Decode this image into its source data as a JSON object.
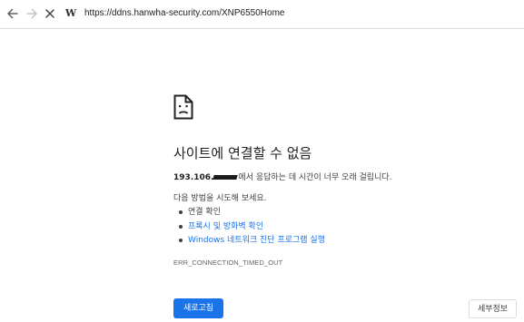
{
  "browser": {
    "address_bar": "https://ddns.hanwha-security.com/XNP6550Home",
    "favicon_glyph": "W",
    "icons": {
      "back": "arrow-left-icon",
      "forward": "arrow-right-icon",
      "stop": "close-icon"
    }
  },
  "error_page": {
    "icon": "sad-document-icon",
    "title": "사이트에 연결할 수 없음",
    "description": {
      "host_prefix": "193.106.",
      "host_suffix": "에서 응답하는 데 시간이 너무 오래 걸립니다."
    },
    "try_heading": "다음 방법을 시도해 보세요.",
    "suggestions": [
      {
        "label": "연결 확인",
        "link": false
      },
      {
        "label": "프록시 및 방화벽 확인",
        "link": true
      },
      {
        "label": "Windows 네트워크 진단 프로그램 실행",
        "link": true
      }
    ],
    "error_code": "ERR_CONNECTION_TIMED_OUT",
    "reload_button": "새로고침",
    "details_button": "세부정보"
  },
  "colors": {
    "accent": "#1a73e8",
    "text": "#202124",
    "secondary_text": "#5f6368"
  }
}
